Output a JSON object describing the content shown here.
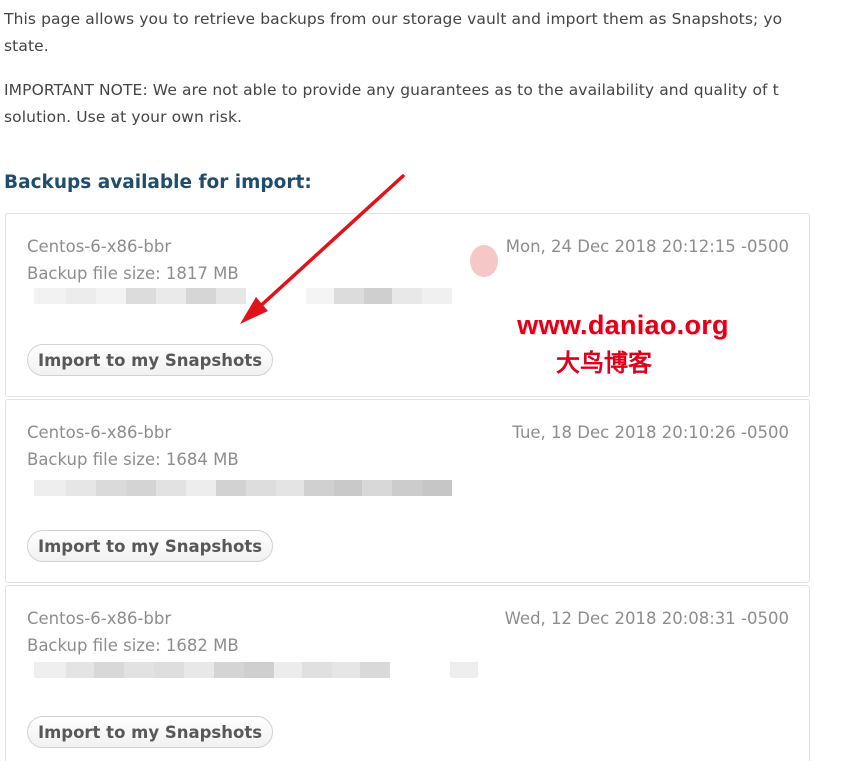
{
  "intro": {
    "paragraph1_line1": "This page allows you to retrieve backups from our storage vault and import them as Snapshots; yo",
    "paragraph1_line2": "state.",
    "paragraph2_line1": "IMPORTANT NOTE: We are not able to provide any guarantees as to the availability and quality of t",
    "paragraph2_line2": "solution. Use at your own risk."
  },
  "heading": "Backups available for import:",
  "backups": [
    {
      "name": "Centos-6-x86-bbr",
      "size": "Backup file size: 1817 MB",
      "date": "Mon, 24 Dec 2018 20:12:15 -0500",
      "button": "Import to my Snapshots"
    },
    {
      "name": "Centos-6-x86-bbr",
      "size": "Backup file size: 1684 MB",
      "date": "Tue, 18 Dec 2018 20:10:26 -0500",
      "button": "Import to my Snapshots"
    },
    {
      "name": "Centos-6-x86-bbr",
      "size": "Backup file size: 1682 MB",
      "date": "Wed, 12 Dec 2018 20:08:31 -0500",
      "button": "Import to my Snapshots"
    }
  ],
  "watermark": {
    "url": "www.daniao.org",
    "cn": "大鸟博客"
  },
  "colors": {
    "heading": "#1f4d6e",
    "arrow": "#e0131a",
    "watermark": "#e0001a"
  }
}
